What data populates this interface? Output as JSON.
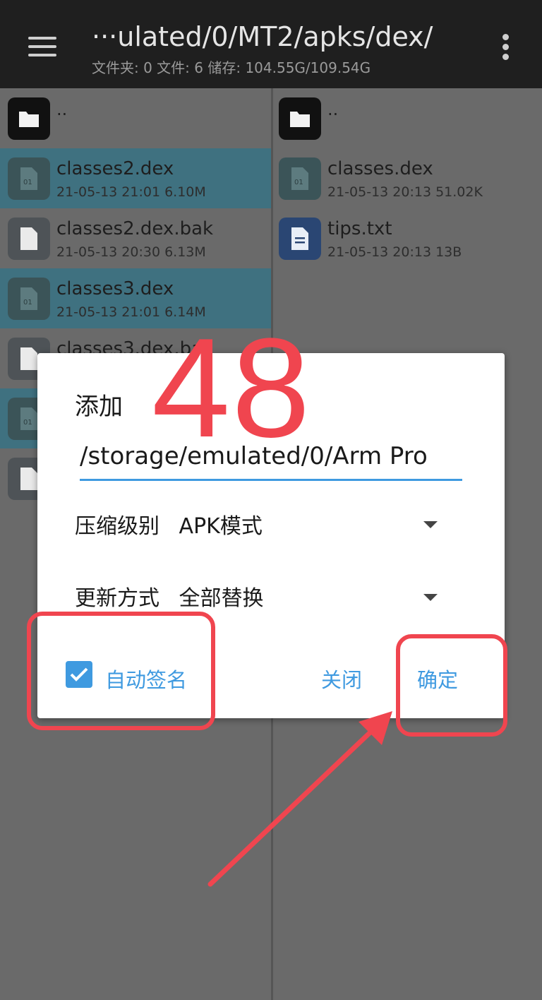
{
  "header": {
    "path": "···ulated/0/MT2/apks/dex/",
    "stats": "文件夹: 0  文件: 6  储存: 104.55G/109.54G"
  },
  "left_pane": {
    "up_label": "..",
    "files": [
      {
        "name": "classes2.dex",
        "meta": "21-05-13 21:01  6.10M",
        "type": "dex",
        "selected": true
      },
      {
        "name": "classes2.dex.bak",
        "meta": "21-05-13 20:30  6.13M",
        "type": "doc",
        "selected": false
      },
      {
        "name": "classes3.dex",
        "meta": "21-05-13 21:01  6.14M",
        "type": "dex",
        "selected": true
      },
      {
        "name": "classes3.dex.ba",
        "meta": "",
        "type": "doc",
        "selected": false
      }
    ]
  },
  "right_pane": {
    "up_label": "..",
    "files": [
      {
        "name": "classes.dex",
        "meta": "21-05-13 20:13  51.02K",
        "type": "dex"
      },
      {
        "name": "tips.txt",
        "meta": "21-05-13 20:13  13B",
        "type": "txt"
      }
    ]
  },
  "dialog": {
    "title": "添加",
    "path_value": "/storage/emulated/0/Arm Pro",
    "compression_label": "压缩级别",
    "compression_value": "APK模式",
    "update_label": "更新方式",
    "update_value": "全部替换",
    "auto_sign_label": "自动签名",
    "auto_sign_checked": true,
    "close_label": "关闭",
    "confirm_label": "确定"
  },
  "annotation": {
    "step_number": "48",
    "color": "#f0454f"
  },
  "colors": {
    "accent": "#3f9ae0",
    "selected_row": "#3f7180"
  }
}
